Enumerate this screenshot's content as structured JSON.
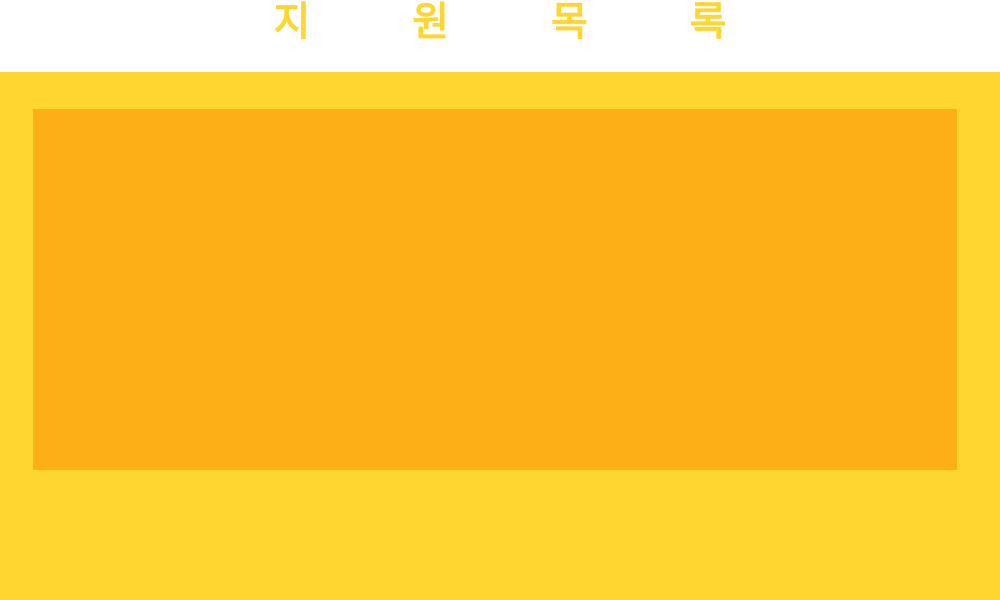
{
  "header": {
    "title": "지 원 목 록"
  },
  "colors": {
    "title_text": "#FFD530",
    "panel_background": "#FFD530",
    "content_area": "#FDAF17",
    "page_background": "#FFFFFF"
  }
}
